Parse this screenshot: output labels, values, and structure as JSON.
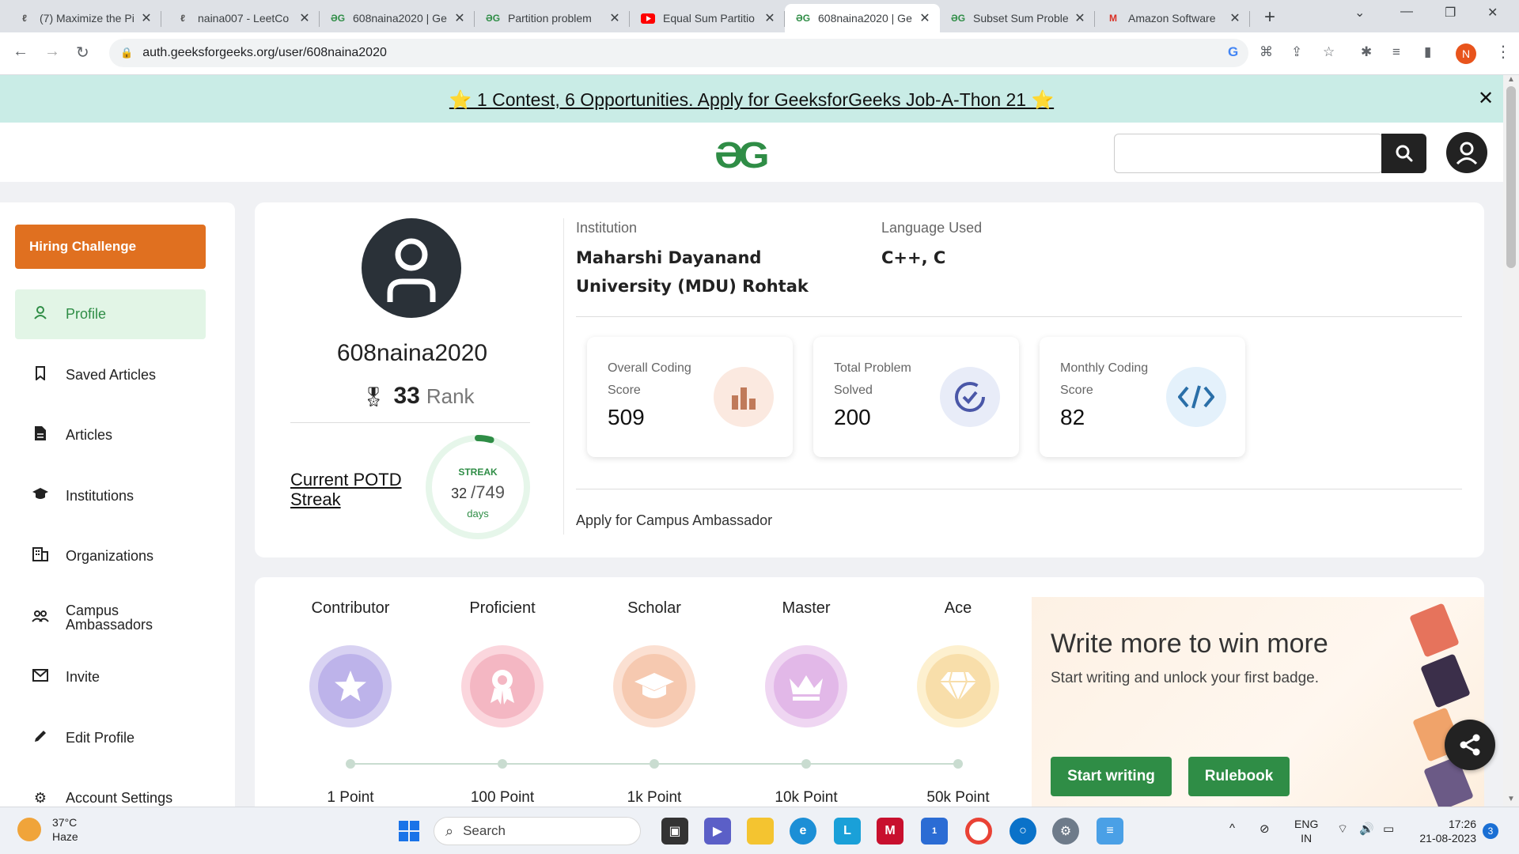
{
  "browser": {
    "tabs": [
      {
        "title": "(7) Maximize the Pi",
        "icon": "leetcode-icon",
        "active": false
      },
      {
        "title": "naina007 - LeetCo",
        "icon": "leetcode-icon",
        "active": false
      },
      {
        "title": "608naina2020 | Ge",
        "icon": "gfg-icon",
        "active": false
      },
      {
        "title": "Partition problem",
        "icon": "gfg-icon",
        "active": false
      },
      {
        "title": "Equal Sum Partitio",
        "icon": "youtube-icon",
        "active": false
      },
      {
        "title": "608naina2020 | Ge",
        "icon": "gfg-icon",
        "active": true
      },
      {
        "title": "Subset Sum Proble",
        "icon": "gfg-icon",
        "active": false
      },
      {
        "title": "Amazon Software",
        "icon": "gmail-icon",
        "active": false
      }
    ],
    "url": "auth.geeksforgeeks.org/user/608naina2020",
    "profile_initial": "N"
  },
  "banner": {
    "text": "⭐ 1 Contest, 6 Opportunities. Apply for GeeksforGeeks Job-A-Thon 21 ⭐",
    "close": "✕"
  },
  "header": {
    "logo": "ƏG"
  },
  "sidebar": {
    "hiring": "Hiring Challenge",
    "items": [
      {
        "label": "Profile",
        "icon": "user-icon"
      },
      {
        "label": "Saved Articles",
        "icon": "bookmark-icon"
      },
      {
        "label": "Articles",
        "icon": "document-icon"
      },
      {
        "label": "Institutions",
        "icon": "graduation-cap-icon"
      },
      {
        "label": "Organizations",
        "icon": "building-icon"
      },
      {
        "label": "Campus Ambassadors",
        "icon": "group-icon"
      },
      {
        "label": "Invite",
        "icon": "mail-icon"
      },
      {
        "label": "Edit Profile",
        "icon": "pencil-icon"
      },
      {
        "label": "Account Settings",
        "icon": "gear-icon"
      }
    ]
  },
  "profile": {
    "username": "608naina2020",
    "rank": "33",
    "rank_label": "Rank",
    "potd_label": "Current POTD Streak",
    "streak_title": "STREAK",
    "streak_current": "32",
    "streak_total": "/749",
    "streak_days": "days",
    "streak_progress": 0.043,
    "institution_label": "Institution",
    "institution": "Maharshi Dayanand University (MDU) Rohtak",
    "language_label": "Language Used",
    "languages": "C++, C",
    "campus_link": "Apply for Campus Ambassador"
  },
  "stats": [
    {
      "label": "Overall Coding Score",
      "value": "509",
      "icon": "bar-chart-icon",
      "color": "#fbe9e0"
    },
    {
      "label": "Total Problem Solved",
      "value": "200",
      "icon": "check-circle-icon",
      "color": "#e8ecf8"
    },
    {
      "label": "Monthly Coding Score",
      "value": "82",
      "icon": "code-icon",
      "color": "#e4f1fb"
    }
  ],
  "badges": [
    {
      "name": "Contributor",
      "points": "1 Point",
      "icon": "star-icon",
      "color": "#d8d2f2",
      "inner": "#bdb3ea"
    },
    {
      "name": "Proficient",
      "points": "100 Point",
      "icon": "ribbon-icon",
      "color": "#fbd6dd",
      "inner": "#f4b7c3"
    },
    {
      "name": "Scholar",
      "points": "1k Point",
      "icon": "graduation-cap-icon",
      "color": "#fbe0d2",
      "inner": "#f6c9b0"
    },
    {
      "name": "Master",
      "points": "10k Point",
      "icon": "crown-icon",
      "color": "#efd6f2",
      "inner": "#e2b8e8"
    },
    {
      "name": "Ace",
      "points": "50k Point",
      "icon": "diamond-icon",
      "color": "#fdf0cf",
      "inner": "#f8deaa"
    }
  ],
  "write": {
    "title": "Write more to win more",
    "subtitle": "Start writing and unlock your first badge.",
    "start_button": "Start writing",
    "rulebook_button": "Rulebook"
  },
  "taskbar": {
    "temperature": "37°C",
    "weather": "Haze",
    "search": "Search",
    "lang_line1": "ENG",
    "lang_line2": "IN",
    "time": "17:26",
    "date": "21-08-2023",
    "notifications": "3",
    "badge_count": "1"
  }
}
